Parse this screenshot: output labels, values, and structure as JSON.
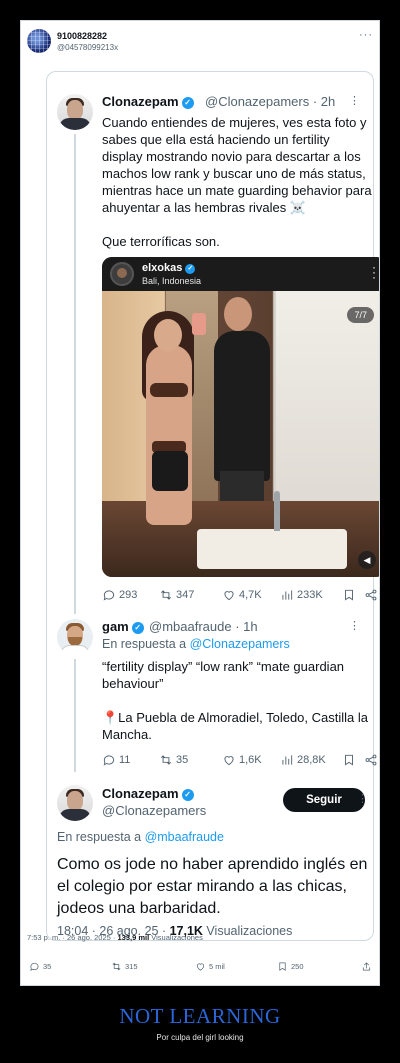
{
  "outer_tweet": {
    "name": "9100828282",
    "handle": "@04578099213x",
    "timestamp": "7:53 p. m. · 26 ago. 2025 · ",
    "views_count": "133,9 mil",
    "views_label": " Visualizaciones",
    "stats": {
      "replies": "35",
      "retweets": "315",
      "likes": "5 mil",
      "bookmarks": "250"
    }
  },
  "tweet1": {
    "name": "Clonazepam",
    "handle_time": "@Clonazepamers · 2h",
    "text_line1": "Cuando entiendes de mujeres, ves  esta foto y",
    "text_line2": "sabes que ella está haciendo un fertility",
    "text_line3": "display mostrando novio para descartar a los",
    "text_line4": "machos low rank y buscar uno de más status,",
    "text_line5": "mientras hace un mate guarding behavior para",
    "text_line6": "ahuyentar a las hembras rivales ☠️",
    "text_line7": "Que terroríficas son.",
    "media": {
      "user": "elxokas",
      "location": "Bali, Indonesia",
      "counter": "7/7"
    },
    "stats": {
      "replies": "293",
      "retweets": "347",
      "likes": "4,7K",
      "views": "233K"
    }
  },
  "tweet2": {
    "name": "gam",
    "handle_time": "@mbaafraude · 1h",
    "reply_prefix": "En respuesta a ",
    "reply_mention": "@Clonazepamers",
    "text_line1": "“fertility display” “low rank” “mate guardian",
    "text_line2": "behaviour”",
    "text_line3": "📍La Puebla de Almoradiel, Toledo, Castilla la",
    "text_line4": "Mancha.",
    "stats": {
      "replies": "11",
      "retweets": "35",
      "likes": "1,6K",
      "views": "28,8K"
    }
  },
  "tweet3": {
    "name": "Clonazepam",
    "handle": "@Clonazepamers",
    "follow_label": "Seguir",
    "reply_prefix": "En respuesta a ",
    "reply_mention": "@mbaafraude",
    "text_line1": "Como os jode no haber aprendido inglés en",
    "text_line2": "el colegio por estar mirando a las chicas,",
    "text_line3": "jodeos una barbaridad.",
    "timestamp": "18:04 · 26 ago. 25 · ",
    "views_count": "17,1K",
    "views_label": " Visualizaciones"
  },
  "caption": {
    "title": "NOT LEARNING",
    "subtitle": "Por culpa del girl looking"
  },
  "colors": {
    "accent": "#1d9bf0",
    "caption_title": "#2a66d9",
    "text": "#0f1419",
    "muted": "#536471"
  }
}
